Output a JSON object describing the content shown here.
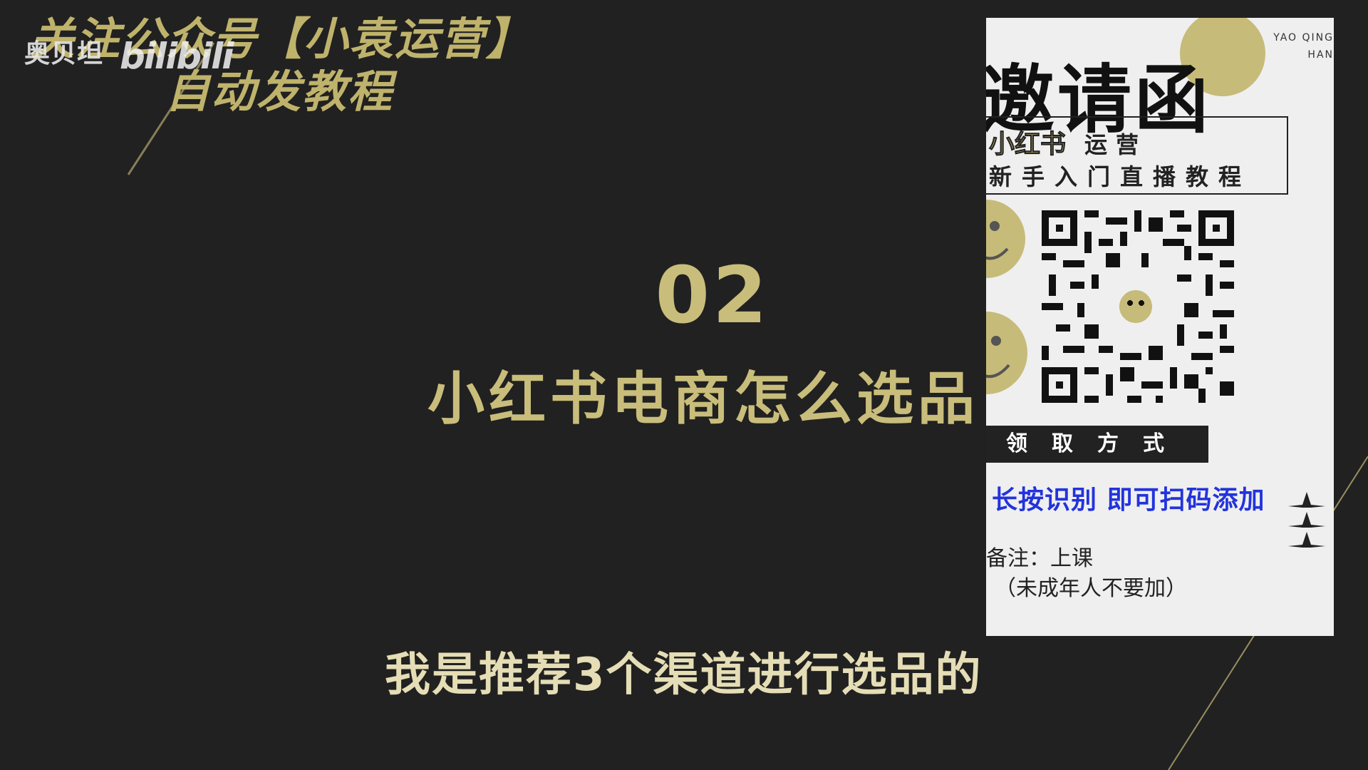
{
  "promo": {
    "line1": "关注公众号【小袁运营】",
    "line2": "自动发教程"
  },
  "watermark": {
    "name": "奥贝坦",
    "logo": "bilibili"
  },
  "section": {
    "number": "02",
    "title": "小红书电商怎么选品"
  },
  "subtitle": "我是推荐3个渠道进行选品的",
  "card": {
    "corner_text_1": "YAO QING",
    "corner_text_2": "HAN",
    "title": "邀请函",
    "brand": "小红书",
    "brand_suffix": "运营",
    "course": "新手入门直播教程",
    "method_label": "领取方式",
    "instruction": "长按识别 即可扫码添加",
    "note": "备注：上课",
    "note2": "（未成年人不要加）",
    "colors": {
      "accent": "#c6bb78",
      "instruction": "#2233dd"
    },
    "qr_icon": "qr-code-icon",
    "face_icon": "smiley-face-icon"
  },
  "colors": {
    "background": "#212121",
    "gold": "#c9bd7b"
  }
}
